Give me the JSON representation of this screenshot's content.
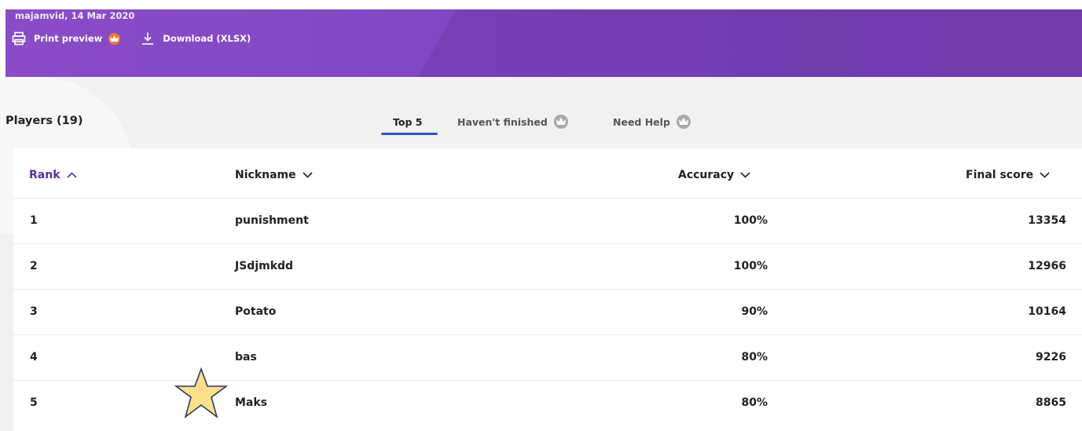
{
  "header": {
    "meta": "majamvid, 14 Mar 2020",
    "print_label": "Print preview",
    "download_label": "Download (XLSX)",
    "accent": "#8a4cc6",
    "badge_color": "#f07a2e"
  },
  "players": {
    "title": "Players (19)"
  },
  "tabs": [
    {
      "label": "Top 5",
      "active": true
    },
    {
      "label": "Haven't finished",
      "active": false,
      "icon": "crown-icon"
    },
    {
      "label": "Need Help",
      "active": false,
      "icon": "crown-icon"
    }
  ],
  "table": {
    "columns": [
      {
        "label": "Rank",
        "sort": "asc"
      },
      {
        "label": "Nickname",
        "sort": "none"
      },
      {
        "label": "Accuracy",
        "sort": "none"
      },
      {
        "label": "Final score",
        "sort": "none"
      }
    ],
    "rows": [
      {
        "rank": "1",
        "nickname": "punishment",
        "accuracy": "100%",
        "score": "13354"
      },
      {
        "rank": "2",
        "nickname": "JSdjmkdd",
        "accuracy": "100%",
        "score": "12966"
      },
      {
        "rank": "3",
        "nickname": "Potato",
        "accuracy": "90%",
        "score": "10164"
      },
      {
        "rank": "4",
        "nickname": "bas",
        "accuracy": "80%",
        "score": "9226"
      },
      {
        "rank": "5",
        "nickname": "Maks",
        "accuracy": "80%",
        "score": "8865"
      }
    ]
  },
  "annotation": {
    "icon": "star-icon",
    "color": "#fbe08a"
  }
}
